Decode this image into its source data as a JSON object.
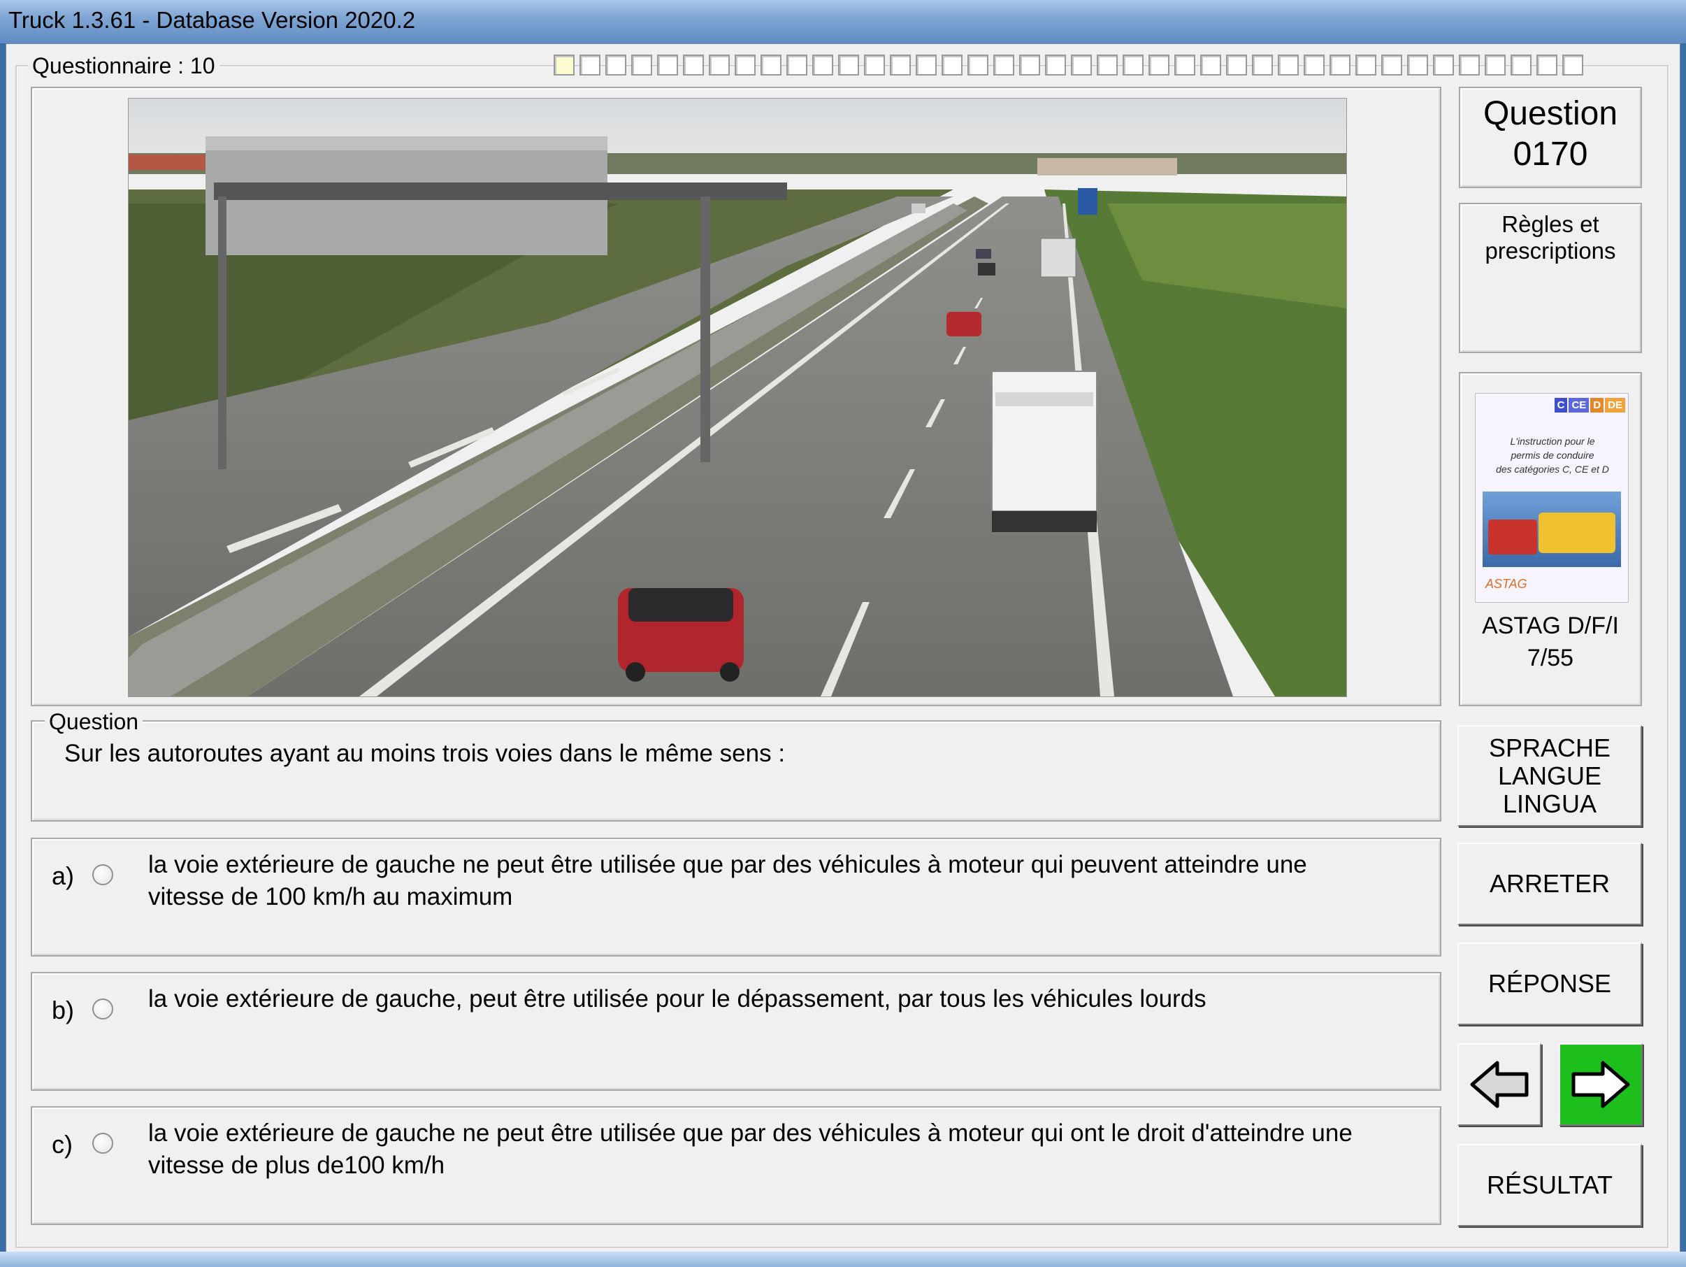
{
  "window": {
    "title": "Truck 1.3.61 - Database Version 2020.2"
  },
  "questionnaire": {
    "label": "Questionnaire : 10",
    "progress_total": 40,
    "progress_current": 1
  },
  "question_number": {
    "line1": "Question",
    "line2": "0170"
  },
  "category": {
    "line1": "Règles et",
    "line2": "prescriptions"
  },
  "book": {
    "badges": [
      "C",
      "CE",
      "D",
      "DE"
    ],
    "cover_text": [
      "L'instruction pour le",
      "permis de conduire",
      "des catégories C, CE et D"
    ],
    "caption1": "ASTAG D/F/I",
    "caption2": "7/55"
  },
  "question": {
    "legend": "Question",
    "text": "Sur les autoroutes ayant au moins trois voies dans le même sens :"
  },
  "answers": [
    {
      "letter": "a)",
      "line1": "la voie extérieure de gauche ne peut être utilisée que par des véhicules à moteur qui peuvent atteindre une",
      "line2": "vitesse de 100 km/h au maximum"
    },
    {
      "letter": "b)",
      "line1": "la voie extérieure de gauche, peut être utilisée pour le dépassement, par tous les véhicules lourds",
      "line2": ""
    },
    {
      "letter": "c)",
      "line1": "la voie extérieure de gauche ne peut être utilisée que par des véhicules à moteur qui ont le droit d'atteindre une",
      "line2": "vitesse de plus de100 km/h"
    }
  ],
  "buttons": {
    "language": {
      "line1": "SPRACHE",
      "line2": "LANGUE",
      "line3": "LINGUA"
    },
    "stop": "ARRETER",
    "answer": "RÉPONSE",
    "result": "RÉSULTAT"
  },
  "colors": {
    "next_button": "#1dbf1d",
    "highlight_cell": "#fdfbd0"
  },
  "icons": {
    "prev": "arrow-left-icon",
    "next": "arrow-right-icon"
  }
}
